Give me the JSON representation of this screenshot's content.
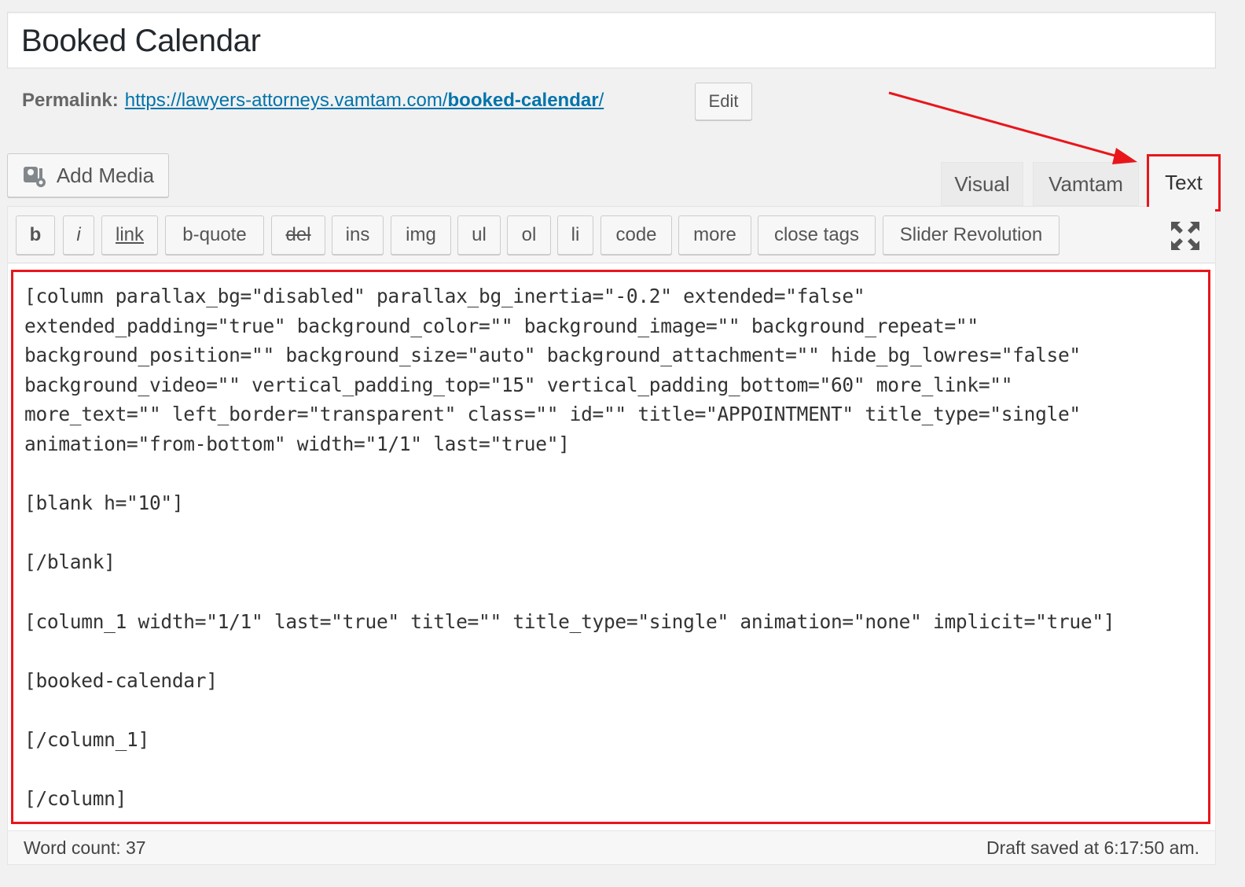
{
  "post": {
    "title": "Booked Calendar",
    "permalink_label": "Permalink:",
    "permalink_base": "https://lawyers-attorneys.vamtam.com/",
    "permalink_slug": "booked-calendar",
    "permalink_trailing": "/",
    "edit_label": "Edit"
  },
  "media": {
    "add_media_label": "Add Media"
  },
  "tabs": {
    "visual": "Visual",
    "vamtam": "Vamtam",
    "text": "Text",
    "active": "Text"
  },
  "quicktags": [
    "b",
    "i",
    "link",
    "b-quote",
    "del",
    "ins",
    "img",
    "ul",
    "ol",
    "li",
    "code",
    "more",
    "close tags",
    "Slider Revolution"
  ],
  "editor": {
    "content": "[column parallax_bg=\"disabled\" parallax_bg_inertia=\"-0.2\" extended=\"false\"\nextended_padding=\"true\" background_color=\"\" background_image=\"\" background_repeat=\"\"\nbackground_position=\"\" background_size=\"auto\" background_attachment=\"\" hide_bg_lowres=\"false\"\nbackground_video=\"\" vertical_padding_top=\"15\" vertical_padding_bottom=\"60\" more_link=\"\"\nmore_text=\"\" left_border=\"transparent\" class=\"\" id=\"\" title=\"APPOINTMENT\" title_type=\"single\"\nanimation=\"from-bottom\" width=\"1/1\" last=\"true\"]\n\n[blank h=\"10\"]\n\n[/blank]\n\n[column_1 width=\"1/1\" last=\"true\" title=\"\" title_type=\"single\" animation=\"none\" implicit=\"true\"]\n\n[booked-calendar]\n\n[/column_1]\n\n[/column]"
  },
  "status": {
    "word_count": "Word count: 37",
    "draft_saved": "Draft saved at 6:17:50 am."
  },
  "annotation": {
    "highlight_color": "#e8161b"
  }
}
